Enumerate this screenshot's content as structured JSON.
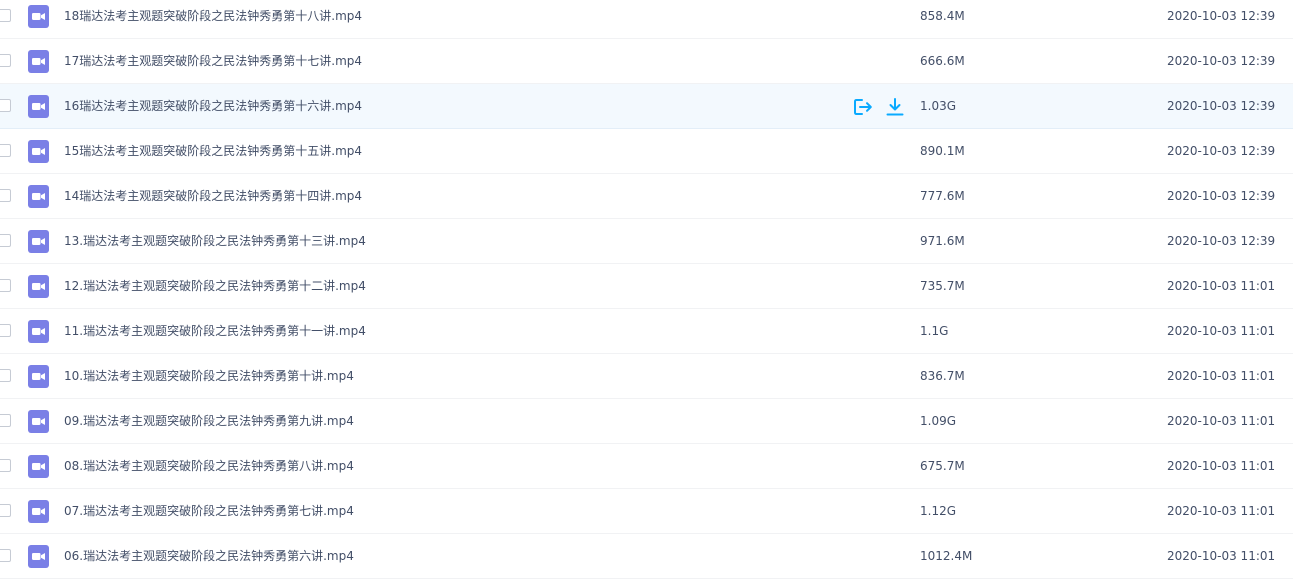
{
  "accent_color": "#09aaff",
  "file_icon_color": "#7a7fe6",
  "files": [
    {
      "name": "18瑞达法考主观题突破阶段之民法钟秀勇第十八讲.mp4",
      "size": "858.4M",
      "date": "2020-10-03 12:39",
      "icon": "video-file-icon"
    },
    {
      "name": "17瑞达法考主观题突破阶段之民法钟秀勇第十七讲.mp4",
      "size": "666.6M",
      "date": "2020-10-03 12:39",
      "icon": "video-file-icon"
    },
    {
      "name": "16瑞达法考主观题突破阶段之民法钟秀勇第十六讲.mp4",
      "size": "1.03G",
      "date": "2020-10-03 12:39",
      "icon": "video-file-icon",
      "hovered": true
    },
    {
      "name": "15瑞达法考主观题突破阶段之民法钟秀勇第十五讲.mp4",
      "size": "890.1M",
      "date": "2020-10-03 12:39",
      "icon": "video-file-icon"
    },
    {
      "name": "14瑞达法考主观题突破阶段之民法钟秀勇第十四讲.mp4",
      "size": "777.6M",
      "date": "2020-10-03 12:39",
      "icon": "video-file-icon"
    },
    {
      "name": "13.瑞达法考主观题突破阶段之民法钟秀勇第十三讲.mp4",
      "size": "971.6M",
      "date": "2020-10-03 12:39",
      "icon": "video-file-icon"
    },
    {
      "name": "12.瑞达法考主观题突破阶段之民法钟秀勇第十二讲.mp4",
      "size": "735.7M",
      "date": "2020-10-03 11:01",
      "icon": "video-file-icon"
    },
    {
      "name": "11.瑞达法考主观题突破阶段之民法钟秀勇第十一讲.mp4",
      "size": "1.1G",
      "date": "2020-10-03 11:01",
      "icon": "video-file-icon"
    },
    {
      "name": "10.瑞达法考主观题突破阶段之民法钟秀勇第十讲.mp4",
      "size": "836.7M",
      "date": "2020-10-03 11:01",
      "icon": "video-file-icon"
    },
    {
      "name": "09.瑞达法考主观题突破阶段之民法钟秀勇第九讲.mp4",
      "size": "1.09G",
      "date": "2020-10-03 11:01",
      "icon": "video-file-icon"
    },
    {
      "name": "08.瑞达法考主观题突破阶段之民法钟秀勇第八讲.mp4",
      "size": "675.7M",
      "date": "2020-10-03 11:01",
      "icon": "video-file-icon"
    },
    {
      "name": "07.瑞达法考主观题突破阶段之民法钟秀勇第七讲.mp4",
      "size": "1.12G",
      "date": "2020-10-03 11:01",
      "icon": "video-file-icon"
    },
    {
      "name": "06.瑞达法考主观题突破阶段之民法钟秀勇第六讲.mp4",
      "size": "1012.4M",
      "date": "2020-10-03 11:01",
      "icon": "video-file-icon"
    }
  ],
  "hover_actions": [
    {
      "icon": "share-icon"
    },
    {
      "icon": "download-icon"
    }
  ]
}
